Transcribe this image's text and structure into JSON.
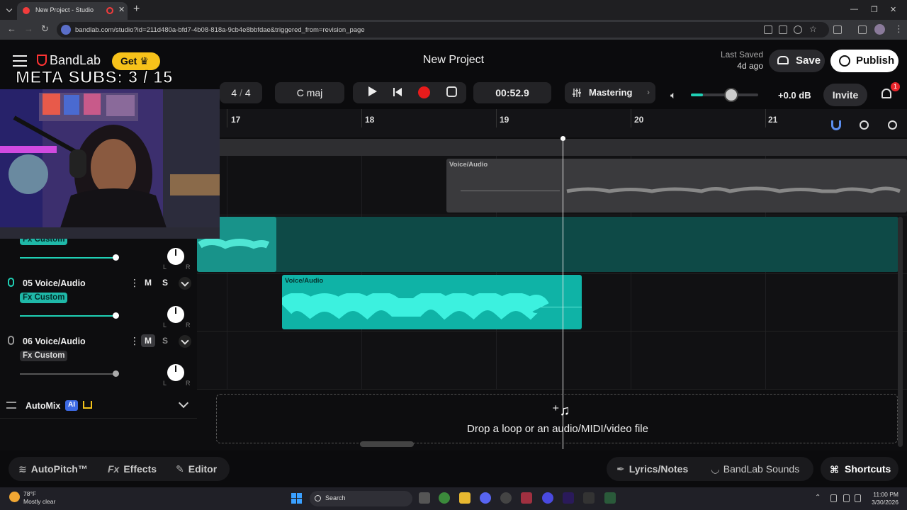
{
  "browser": {
    "tab_title": "New Project - Studio",
    "url": "bandlab.com/studio?id=211d480a-bfd7-4b08-818a-9cb4e8bbfdae&triggered_from=revision_page"
  },
  "header": {
    "logo": "BandLab",
    "get_label": "Get",
    "project_title": "New Project",
    "last_saved_label": "Last Saved",
    "last_saved_value": "4d ago",
    "save_label": "Save",
    "publish_label": "Publish"
  },
  "overlay": {
    "meta_subs": "META SUBS: 3 / 15"
  },
  "transport": {
    "time_signature_num": "4",
    "time_signature_sep": "/",
    "time_signature_den": "4",
    "key": "C maj",
    "timecode": "00:52.9",
    "mastering_label": "Mastering",
    "volume_db": "+0.0 dB",
    "master_volume_level": 0.6,
    "invite_label": "Invite",
    "notification_count": "1"
  },
  "ruler": {
    "bars": [
      "17",
      "18",
      "19",
      "20",
      "21"
    ]
  },
  "clips": {
    "top_name": "Voice/Audio",
    "voice5_name": "Voice/Audio"
  },
  "tracks": [
    {
      "name": "",
      "fx": "Fx Custom",
      "fx_active": true,
      "mute": "",
      "solo": "",
      "volume": 0.98,
      "pan_left": "L",
      "pan_right": "R"
    },
    {
      "name": "05  Voice/Audio",
      "fx": "Fx Custom",
      "fx_active": true,
      "mute": "M",
      "solo": "S",
      "volume": 0.98,
      "pan_left": "L",
      "pan_right": "R"
    },
    {
      "name": "06  Voice/Audio",
      "fx": "Fx Custom",
      "fx_active": false,
      "mute": "M",
      "solo": "S",
      "volume": 0.98,
      "pan_left": "L",
      "pan_right": "R"
    }
  ],
  "automix": {
    "label": "AutoMix",
    "ai_badge": "AI"
  },
  "dropzone": {
    "text": "Drop a loop or an audio/MIDI/video file"
  },
  "bottombar": {
    "autopitch": "AutoPitch™",
    "effects_icon": "Fx",
    "effects": "Effects",
    "editor": "Editor",
    "lyrics": "Lyrics/Notes",
    "sounds": "BandLab Sounds",
    "shortcuts": "Shortcuts"
  },
  "taskbar": {
    "temp": "78°F",
    "weather": "Mostly clear",
    "search": "Search",
    "time": "11:00 PM",
    "date": "3/30/2026"
  },
  "colors": {
    "accent": "#1fd0b5",
    "record": "#e81b1b",
    "get_button": "#f7c21a",
    "ai_badge": "#3d6ae3"
  }
}
